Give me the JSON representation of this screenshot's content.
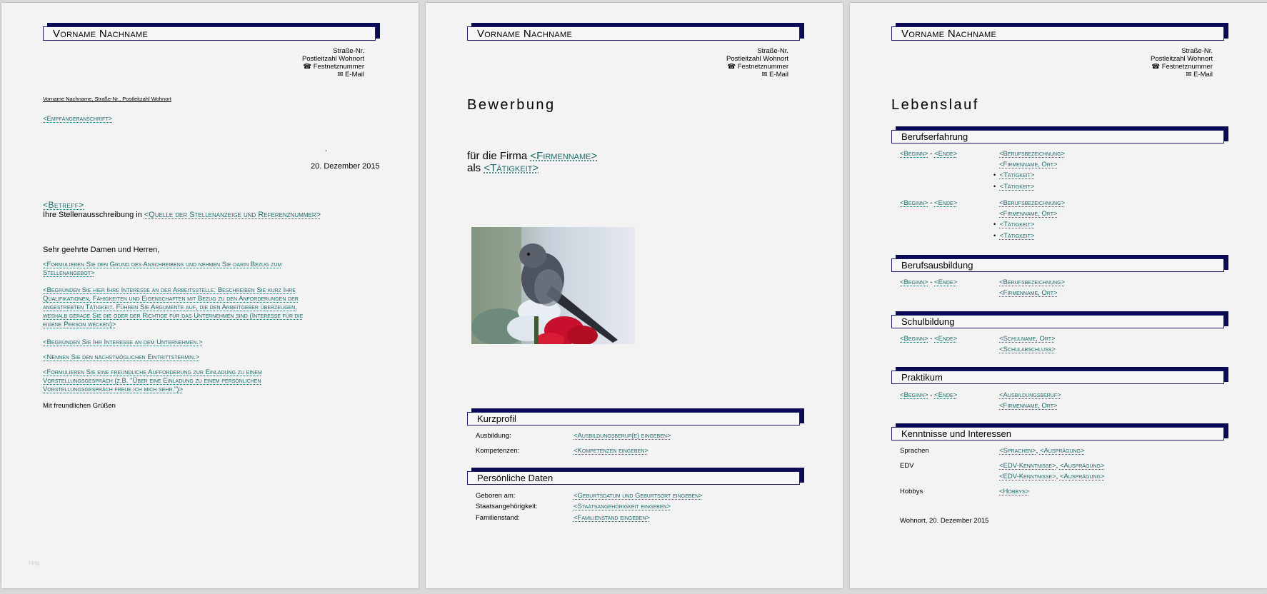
{
  "common": {
    "name": "Vorname Nachname",
    "address": [
      "Straße-Nr.",
      "Postleitzahl  Wohnort",
      "☎ Festnetznummer",
      "✉ E-Mail"
    ]
  },
  "letter": {
    "sender_line": "Vorname Nachname, Straße-Nr., Postleitzahl  Wohnort",
    "recipient": "<Empfängeranschrift>",
    "comma": ",",
    "date": "20. Dezember 2015",
    "subject": "<Betreff>",
    "subject_line_prefix": "Ihre Stellenausschreibung in ",
    "subject_line_placeholder": "<Quelle der Stellenanzeige und Referenznummer>",
    "salutation": "Sehr geehrte Damen und Herren,",
    "paragraphs": [
      [
        "<Formulieren Sie den Grund des Anschreibens und nehmen Sie darin Bezug zum",
        "Stellenangebot>"
      ],
      [
        "<Begründen Sie hier Ihre Interesse an der Arbeitsstelle: Beschreiben Sie kurz Ihre",
        "Qualifikationen, Fähigkeiten und Eigenschaften mit Bezug zu den Anforderungen der",
        "angestrebten Tätigkeit. Führen Sie Argumente auf, die den Arbeitgeber überzeugen,",
        "weshalb gerade Sie die oder der Richtige für das Unternehmen sind (Interesse für die",
        "eigene Person wecken)>"
      ],
      [
        "<Begründen Sie Ihr Interesse an dem Unternehmen.>"
      ],
      [
        "<Nennen Sie den nächstmöglichen Eintrittstermin.>"
      ],
      [
        "<Formulieren Sie eine freundliche Aufforderung zur Einladung zu einem",
        "Vorstellungsgespräch (z.B. \"Über eine Einladung zu einem persönlichen",
        "Vorstellungsgespräch freue ich mich sehr.\")>"
      ]
    ],
    "closing": "Mit freundlichen Grüßen",
    "watermark": "hing"
  },
  "cover": {
    "title": "Bewerbung",
    "firm_prefix": "für die Firma ",
    "firm_placeholder": "<Firmenname>",
    "as_prefix": "als ",
    "as_placeholder": "<Tätigkeit>",
    "kurzprofil_title": "Kurzprofil",
    "kurzprofil": [
      {
        "label": "Ausbildung:",
        "value": "<Ausbildungsberuf(e) eingeben>"
      },
      {
        "label": "Kompetenzen:",
        "value": "<Kompetenzen eingeben>"
      }
    ],
    "personal_title": "Persönliche Daten",
    "personal": [
      {
        "label": "Geboren am:",
        "value": "<Geburtsdatum und Geburtsort eingeben>"
      },
      {
        "label": "Staatsangehörigkeit:",
        "value": "<Staatsangehörigkeit eingeben>"
      },
      {
        "label": "Familienstand:",
        "value": "<Familienstand eingeben>"
      }
    ]
  },
  "cv": {
    "title": "Lebenslauf",
    "period": [
      "<Beginn>",
      " - ",
      "<Ende>"
    ],
    "sections": {
      "berufserfahrung": "Berufserfahrung",
      "berufsausbildung": "Berufsausbildung",
      "schulbildung": "Schulbildung",
      "praktikum": "Praktikum",
      "kenntnisse": "Kenntnisse und Interessen"
    },
    "job": [
      "<Berufsbezeichnung>",
      "<Firmenname, Ort>",
      "<Tätigkeit>",
      "<Tätigkeit>"
    ],
    "ausbildung": [
      "<Berufsbezeichnung>",
      "<Firmenname, Ort>"
    ],
    "schule": [
      "<Schulname, Ort>",
      "<Schulabschluss>"
    ],
    "praktikum": [
      "<Ausbildungsberuf>",
      "<Firmenname, Ort>"
    ],
    "sprachen_label": "Sprachen",
    "sprachen_value": [
      "<Sprachen>",
      ", ",
      "<Ausprägung>"
    ],
    "edv_label": "EDV",
    "edv_value": [
      "<EDV-Kenntnisse>",
      ", ",
      "<Ausprägung>"
    ],
    "hobbys_label": "Hobbys",
    "hobbys_value": "<Hobbys>",
    "place_date": "Wohnort, 20. Dezember 2015"
  }
}
